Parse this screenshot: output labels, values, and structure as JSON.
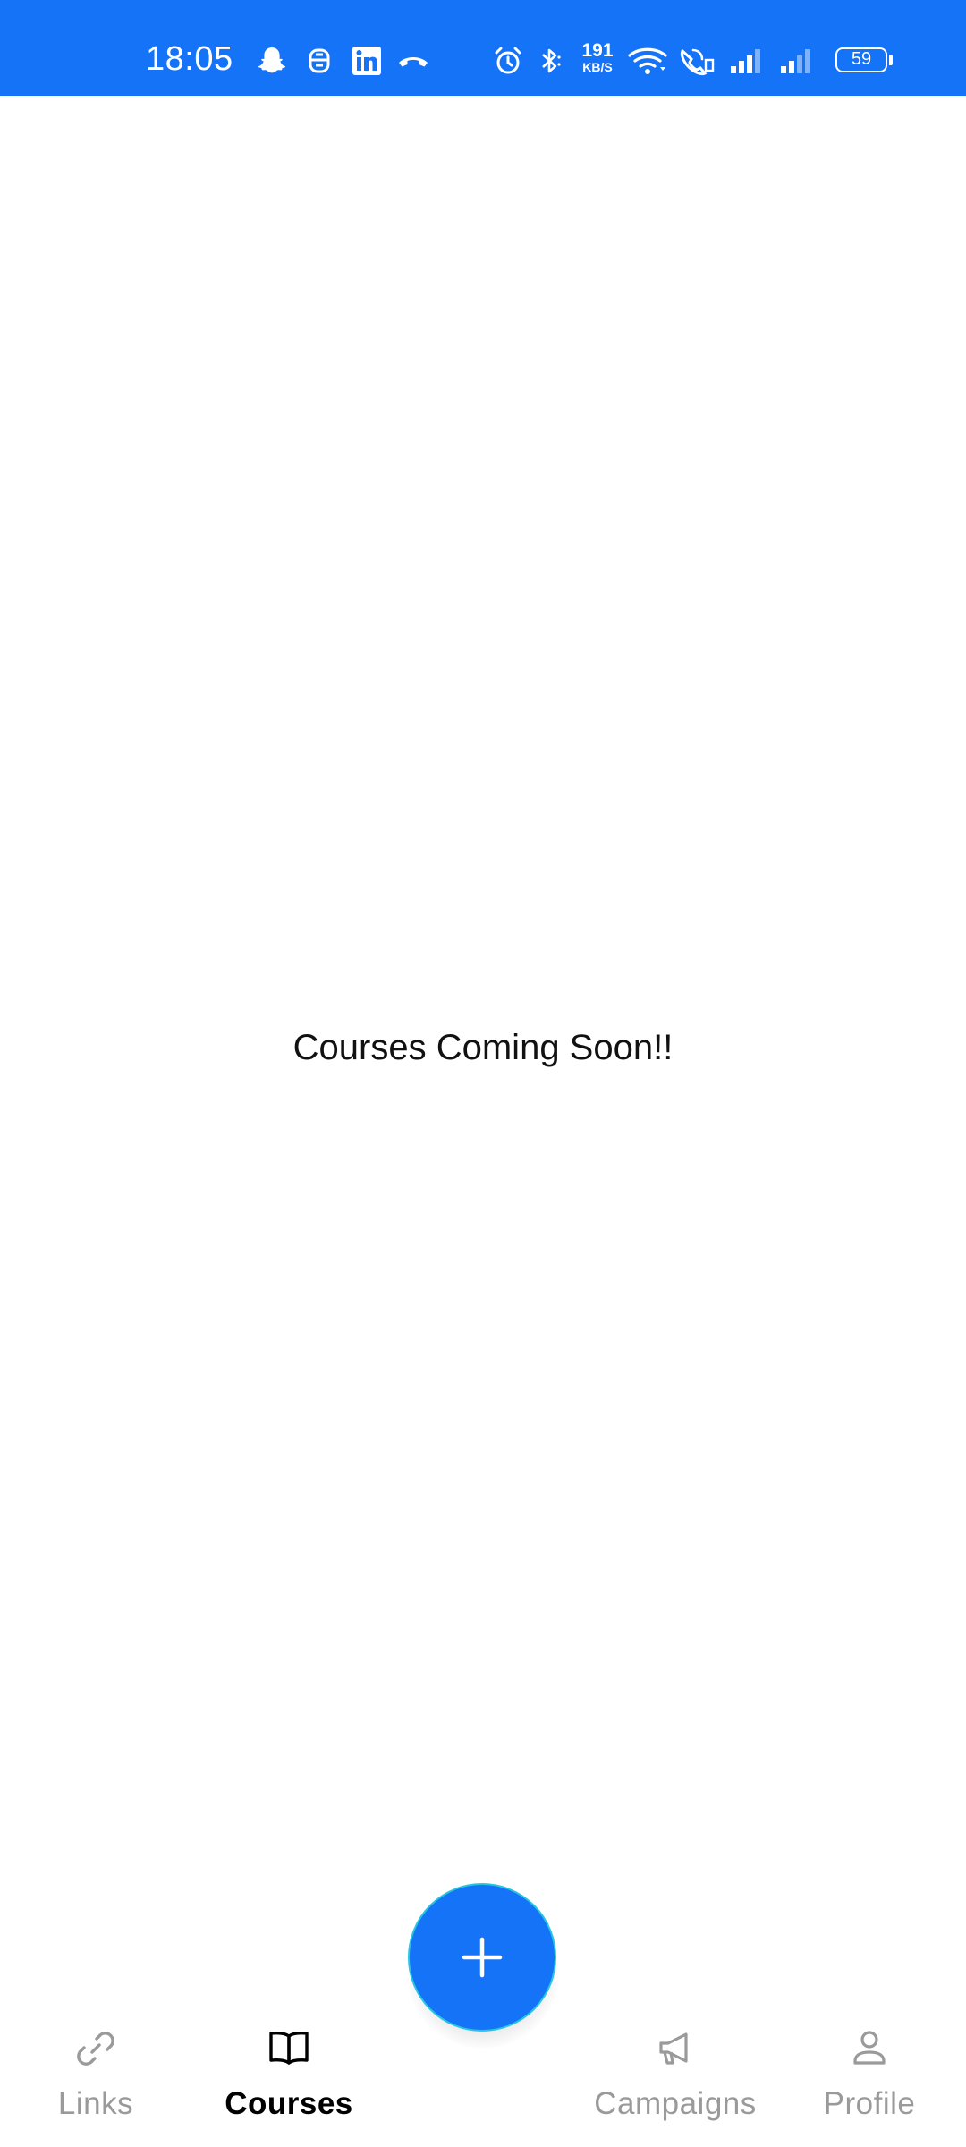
{
  "status_bar": {
    "time": "18:05",
    "net_speed_value": "191",
    "net_speed_unit": "KB/S",
    "battery_level": "59",
    "background_color": "#1473f7",
    "notification_icons": [
      "snapchat-icon",
      "robot-app-icon",
      "linkedin-icon",
      "missed-call-icon"
    ],
    "system_icons": [
      "alarm-icon",
      "bluetooth-icon",
      "wifi-icon",
      "wifi-calling-icon",
      "signal-icon",
      "signal-icon"
    ]
  },
  "main": {
    "message": "Courses Coming Soon!!"
  },
  "fab": {
    "icon": "plus-icon",
    "color": "#1473f7"
  },
  "bottom_nav": {
    "items": [
      {
        "label": "Links",
        "icon": "link-icon",
        "active": false
      },
      {
        "label": "Courses",
        "icon": "book-icon",
        "active": true
      },
      {
        "label": "Campaigns",
        "icon": "megaphone-icon",
        "active": false
      },
      {
        "label": "Profile",
        "icon": "user-icon",
        "active": false
      }
    ],
    "active_color": "#000000",
    "inactive_color": "#9a9a9a"
  }
}
